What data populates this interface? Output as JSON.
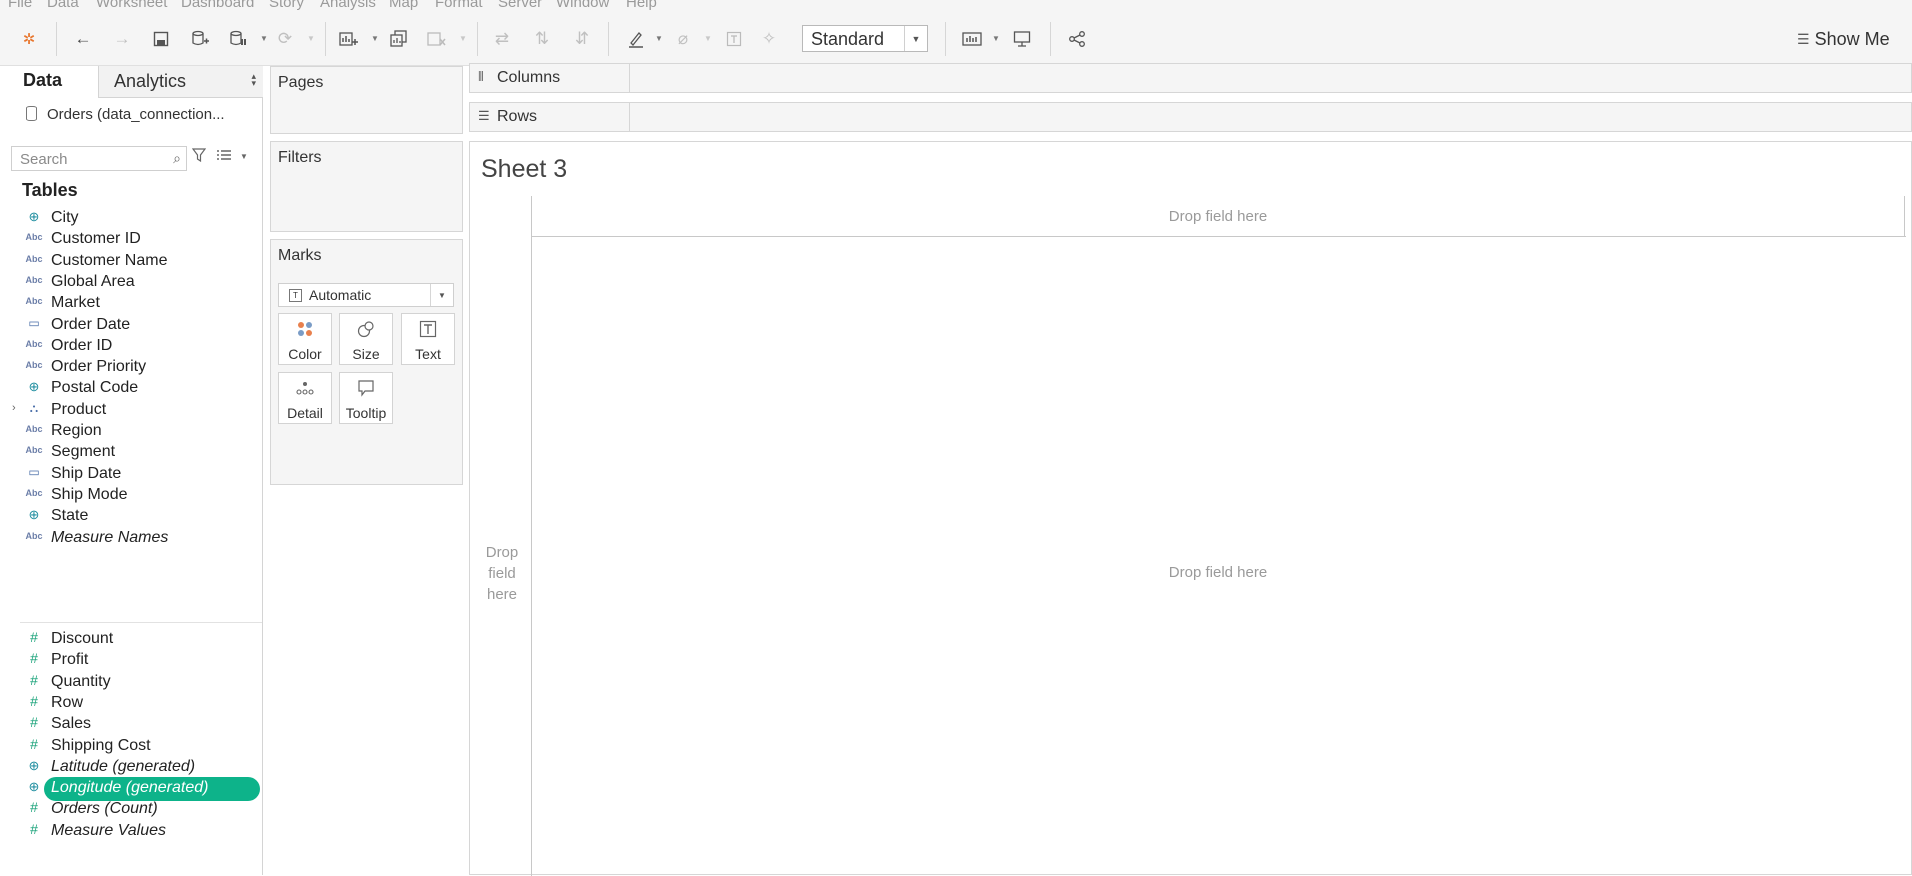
{
  "menu": [
    "File",
    "Data",
    "Worksheet",
    "Dashboard",
    "Story",
    "Analysis",
    "Map",
    "Format",
    "Server",
    "Window",
    "Help"
  ],
  "toolbar": {
    "fit_select": "Standard",
    "show_me": "Show Me",
    "icons": [
      "tableau-logo-icon",
      "undo-icon",
      "redo-icon",
      "save-icon",
      "new-data-source-icon",
      "pause-updates-icon",
      "refresh-icon",
      "new-worksheet-icon",
      "duplicate-sheet-icon",
      "clear-sheet-icon",
      "swap-rows-columns-icon",
      "sort-ascending-icon",
      "sort-descending-icon",
      "highlight-icon",
      "group-members-icon",
      "show-mark-labels-icon",
      "fix-axes-icon",
      "show-cards-icon",
      "presentation-mode-icon",
      "share-icon"
    ]
  },
  "left_pane": {
    "tab_data": "Data",
    "tab_analytics": "Analytics",
    "datasource": "Orders (data_connection...",
    "search_placeholder": "Search",
    "tables_heading": "Tables",
    "dimensions": [
      {
        "icon": "geo",
        "label": "City"
      },
      {
        "icon": "Abc",
        "label": "Customer ID"
      },
      {
        "icon": "Abc",
        "label": "Customer Name"
      },
      {
        "icon": "Abc",
        "label": "Global Area"
      },
      {
        "icon": "Abc",
        "label": "Market"
      },
      {
        "icon": "date",
        "label": "Order Date"
      },
      {
        "icon": "Abc",
        "label": "Order ID"
      },
      {
        "icon": "Abc",
        "label": "Order Priority"
      },
      {
        "icon": "geo",
        "label": "Postal Code"
      },
      {
        "icon": "hierarchy",
        "label": "Product"
      },
      {
        "icon": "Abc",
        "label": "Region"
      },
      {
        "icon": "Abc",
        "label": "Segment"
      },
      {
        "icon": "date",
        "label": "Ship Date"
      },
      {
        "icon": "Abc",
        "label": "Ship Mode"
      },
      {
        "icon": "geo",
        "label": "State"
      },
      {
        "icon": "Abc",
        "label": "Measure Names"
      }
    ],
    "measures": [
      {
        "icon": "#",
        "label": "Discount"
      },
      {
        "icon": "#",
        "label": "Profit"
      },
      {
        "icon": "#",
        "label": "Quantity"
      },
      {
        "icon": "#",
        "label": "Row"
      },
      {
        "icon": "#",
        "label": "Sales"
      },
      {
        "icon": "#",
        "label": "Shipping Cost"
      },
      {
        "icon": "geo",
        "label": "Latitude (generated)"
      },
      {
        "icon": "geo",
        "label": "Longitude (generated)"
      },
      {
        "icon": "#",
        "label": "Orders (Count)"
      },
      {
        "icon": "#",
        "label": "Measure Values"
      }
    ]
  },
  "cards": {
    "pages": "Pages",
    "filters": "Filters",
    "marks": "Marks",
    "mark_type": "Automatic",
    "mark_buttons": [
      "Color",
      "Size",
      "Text",
      "Detail",
      "Tooltip"
    ]
  },
  "shelves": {
    "columns": "Columns",
    "rows": "Rows"
  },
  "view": {
    "sheet_title": "Sheet 3",
    "drop_top": "Drop field here",
    "drop_center": "Drop field here",
    "drop_left": "Drop field here"
  }
}
